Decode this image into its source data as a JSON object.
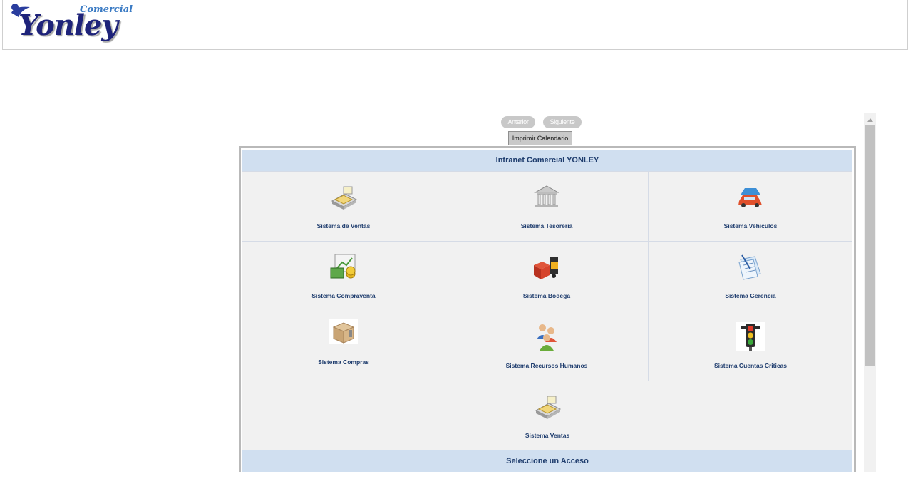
{
  "logo": {
    "small_text": "Comercial",
    "main_text": "Yonley"
  },
  "nav": {
    "prev_label": "Anterior",
    "next_label": "Siguiente",
    "print_label": "Imprimir Calendario"
  },
  "panel": {
    "title": "Intranet Comercial YONLEY",
    "footer": "Seleccione un Acceso",
    "items": [
      {
        "label": "Sistema de Ventas",
        "icon": "cash-register-icon"
      },
      {
        "label": "Sistema Tesoreria",
        "icon": "bank-icon"
      },
      {
        "label": "Sistema Vehiculos",
        "icon": "cars-icon"
      },
      {
        "label": "Sistema Compraventa",
        "icon": "money-chart-icon"
      },
      {
        "label": "Sistema Bodega",
        "icon": "forklift-icon"
      },
      {
        "label": "Sistema Gerencia",
        "icon": "documents-icon"
      },
      {
        "label": "Sistema Compras",
        "icon": "box-icon"
      },
      {
        "label": "Sistema Recursos Humanos",
        "icon": "people-icon"
      },
      {
        "label": "Sistema Cuentas Criticas",
        "icon": "traffic-light-icon"
      }
    ],
    "wide_item": {
      "label": "Sistema Ventas",
      "icon": "cash-register-icon"
    }
  },
  "colors": {
    "header_band": "#d0dff0",
    "link_text": "#1f3d6e",
    "cell_bg": "#f1f1f1"
  }
}
